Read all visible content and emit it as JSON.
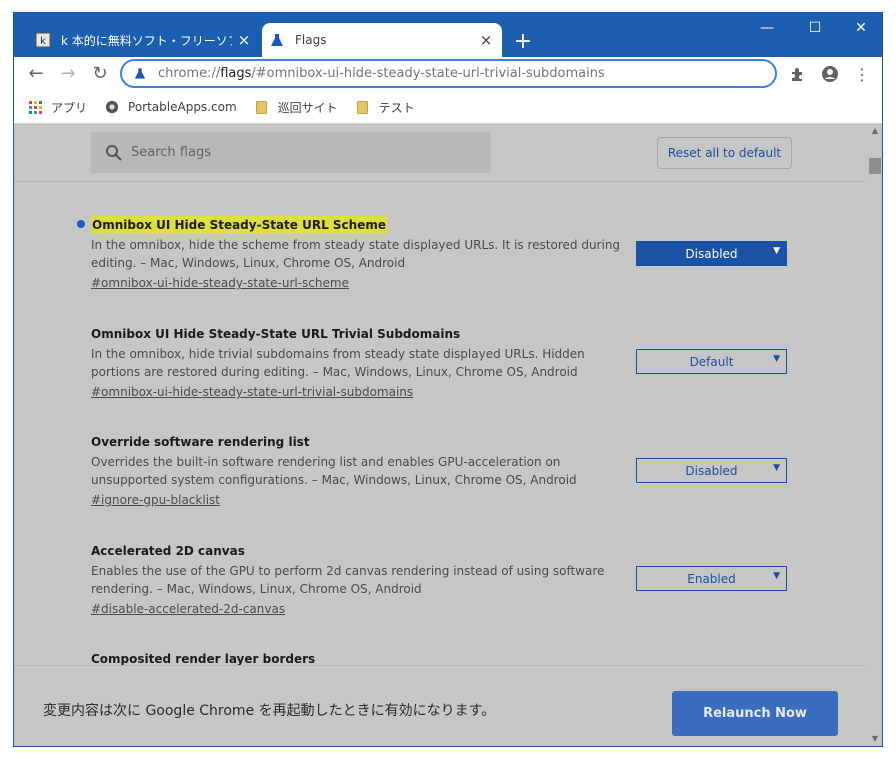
{
  "tabs": [
    {
      "title": "k 本的に無料ソフト・フリーソフト",
      "close": "×",
      "icon": "k-site-favicon"
    },
    {
      "title": "Flags",
      "close": "×",
      "icon": "flask-icon"
    }
  ],
  "new_tab": "+",
  "window_controls": {
    "minimize": "—",
    "maximize": "☐",
    "close": "✕"
  },
  "toolbar": {
    "back": "←",
    "forward": "→",
    "reload": "↻",
    "url_scheme": "chrome://",
    "url_host": "flags",
    "url_path": "/#omnibox-ui-hide-steady-state-url-trivial-subdomains",
    "extensions": "✦",
    "profile": "●",
    "menu": "⋮"
  },
  "bookmarks": [
    {
      "label": "アプリ",
      "icon": "apps-grid-icon"
    },
    {
      "label": "PortableApps.com",
      "icon": "portableapps-icon"
    },
    {
      "label": "巡回サイト",
      "icon": "folder-icon"
    },
    {
      "label": "テスト",
      "icon": "folder-icon"
    }
  ],
  "search": {
    "placeholder": "Search flags"
  },
  "reset_label": "Reset all to default",
  "flags": [
    {
      "title": "Omnibox UI Hide Steady-State URL Scheme",
      "highlighted": true,
      "modified": true,
      "desc": "In the omnibox, hide the scheme from steady state displayed URLs. It is restored during editing. – Mac, Windows, Linux, Chrome OS, Android",
      "link": "#omnibox-ui-hide-steady-state-url-scheme",
      "value": "Disabled"
    },
    {
      "title": "Omnibox UI Hide Steady-State URL Trivial Subdomains",
      "highlighted": false,
      "modified": false,
      "desc": "In the omnibox, hide trivial subdomains from steady state displayed URLs. Hidden portions are restored during editing. – Mac, Windows, Linux, Chrome OS, Android",
      "link": "#omnibox-ui-hide-steady-state-url-trivial-subdomains",
      "value": "Default"
    },
    {
      "title": "Override software rendering list",
      "highlighted": false,
      "modified": false,
      "desc": "Overrides the built-in software rendering list and enables GPU-acceleration on unsupported system configurations. – Mac, Windows, Linux, Chrome OS, Android",
      "link": "#ignore-gpu-blacklist",
      "value": "Disabled"
    },
    {
      "title": "Accelerated 2D canvas",
      "highlighted": false,
      "modified": false,
      "desc": "Enables the use of the GPU to perform 2d canvas rendering instead of using software rendering. – Mac, Windows, Linux, Chrome OS, Android",
      "link": "#disable-accelerated-2d-canvas",
      "value": "Enabled"
    },
    {
      "title": "Composited render layer borders",
      "highlighted": false,
      "modified": false,
      "desc": "",
      "link": "",
      "value": ""
    }
  ],
  "footer": {
    "message": "変更内容は次に Google Chrome を再起動したときに有効になります。",
    "relaunch_label": "Relaunch Now"
  },
  "colors": {
    "frame": "#1c5fb0",
    "accent": "#1a52a6",
    "highlight": "#dede3c",
    "overlay": "#c6c6c6"
  }
}
